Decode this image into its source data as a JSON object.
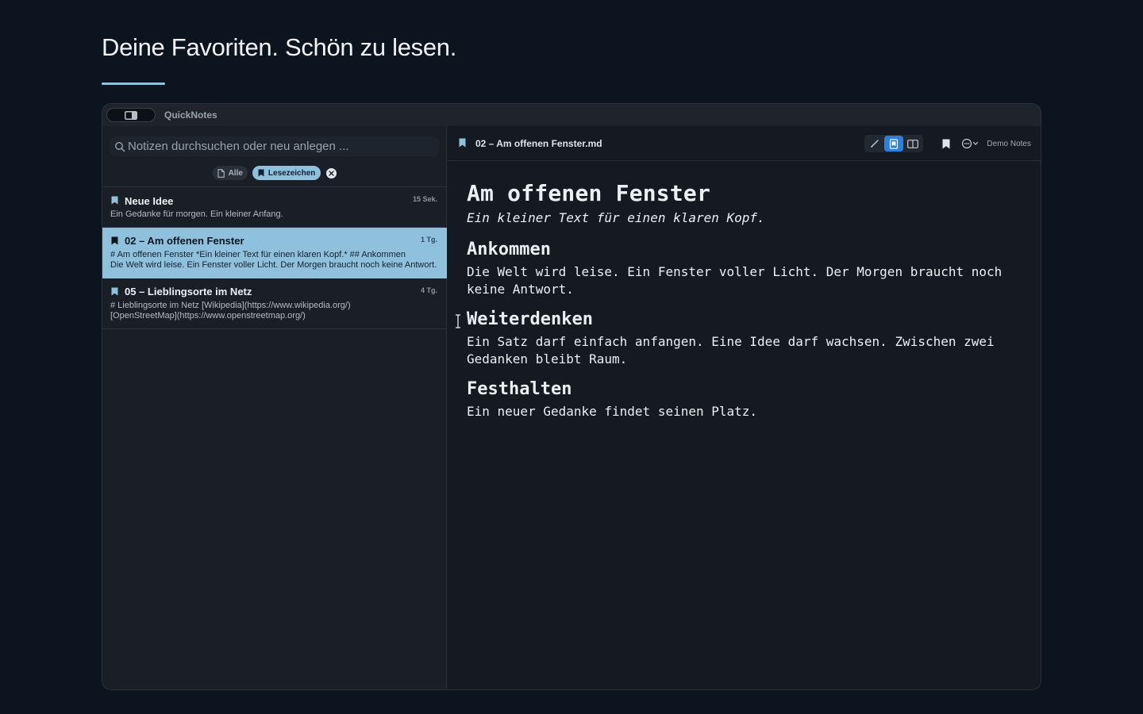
{
  "hero": {
    "title": "Deine Favoriten. Schön zu lesen."
  },
  "app": {
    "name": "QuickNotes"
  },
  "search": {
    "placeholder": "Notizen durchsuchen oder neu anlegen ..."
  },
  "filters": {
    "all_label": "Alle",
    "bookmarks_label": "Lesezeichen"
  },
  "notes": [
    {
      "title": "Neue Idee",
      "time": "15 Sek.",
      "preview": [
        "Ein Gedanke für morgen. Ein kleiner Anfang."
      ]
    },
    {
      "title": "02 – Am offenen Fenster",
      "time": "1 Tg.",
      "preview": [
        "# Am offenen Fenster  *Ein kleiner Text für einen klaren Kopf.*  ## Ankommen",
        "Die Welt wird leise.   Ein Fenster voller Licht.   Der Morgen braucht noch keine Antwort."
      ]
    },
    {
      "title": "05 – Lieblingsorte im Netz",
      "time": "4 Tg.",
      "preview": [
        "# Lieblingsorte im Netz  [Wikipedia](https://www.wikipedia.org/)",
        "[OpenStreetMap](https://www.openstreetmap.org/)"
      ]
    }
  ],
  "editor": {
    "filename": "02 – Am offenen Fenster.md",
    "vault": "Demo Notes"
  },
  "document": {
    "title": "Am offenen Fenster",
    "subtitle": "Ein kleiner Text für einen klaren Kopf.",
    "sections": [
      {
        "heading": "Ankommen",
        "body": "Die Welt wird leise. Ein Fenster voller Licht. Der Morgen braucht noch keine Antwort."
      },
      {
        "heading": "Weiterdenken",
        "body": "Ein Satz darf einfach anfangen. Eine Idee darf wachsen. Zwischen zwei Gedanken bleibt Raum."
      },
      {
        "heading": "Festhalten",
        "body": "Ein neuer Gedanke findet seinen Platz."
      }
    ]
  },
  "colors": {
    "background": "#0c1420",
    "accent": "#8fc1dd",
    "active_mode": "#2f7ed8"
  },
  "icons": {
    "sidebar_toggle": "sidebar-icon",
    "search": "search-icon",
    "filter_all": "document-icon",
    "filter_bookmarks": "bookmark-icon",
    "clear": "close-icon",
    "edit_mode": "pencil-icon",
    "preview_mode": "preview-icon",
    "split_mode": "split-view-icon",
    "more": "more-icon"
  }
}
